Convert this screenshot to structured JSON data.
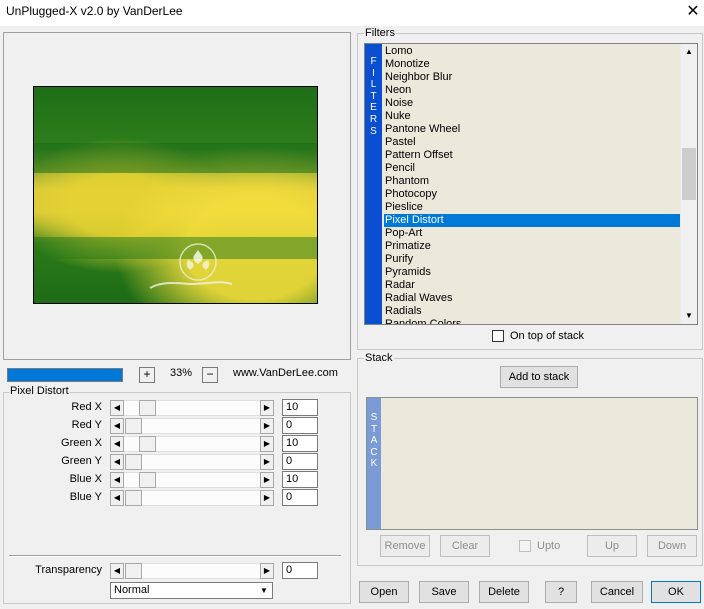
{
  "window": {
    "title": "UnPlugged-X v2.0 by VanDerLee",
    "close_glyph": "✕"
  },
  "zoom": {
    "plus": "+",
    "minus": "−",
    "value": "33%",
    "progress": 1.0
  },
  "website": "www.VanDerLee.com",
  "pixel_distort": {
    "label": "Pixel Distort",
    "params": [
      {
        "label": "Red X",
        "value": "10"
      },
      {
        "label": "Red Y",
        "value": "0"
      },
      {
        "label": "Green X",
        "value": "10"
      },
      {
        "label": "Green Y",
        "value": "0"
      },
      {
        "label": "Blue X",
        "value": "10"
      },
      {
        "label": "Blue Y",
        "value": "0"
      }
    ],
    "transparency": {
      "label": "Transparency",
      "value": "0"
    },
    "blend_mode": "Normal"
  },
  "filters": {
    "label": "Filters",
    "band_letters": [
      "F",
      "I",
      "L",
      "T",
      "E",
      "R",
      "S"
    ],
    "items": [
      "Lomo",
      "Monotize",
      "Neighbor Blur",
      "Neon",
      "Noise",
      "Nuke",
      "Pantone Wheel",
      "Pastel",
      "Pattern Offset",
      "Pencil",
      "Phantom",
      "Photocopy",
      "Pieslice",
      "Pixel Distort",
      "Pop-Art",
      "Primatize",
      "Purify",
      "Pyramids",
      "Radar",
      "Radial Waves",
      "Radials",
      "Random Colors"
    ],
    "selected": "Pixel Distort",
    "on_top_label": "On top of stack"
  },
  "stack": {
    "label": "Stack",
    "add_label": "Add to stack",
    "band_letters": [
      "S",
      "T",
      "A",
      "C",
      "K"
    ],
    "remove_label": "Remove",
    "clear_label": "Clear",
    "upto_label": "Upto",
    "up_label": "Up",
    "down_label": "Down"
  },
  "buttons": {
    "open": "Open",
    "save": "Save",
    "delete": "Delete",
    "help": "?",
    "cancel": "Cancel",
    "ok": "OK"
  },
  "colors": {
    "accent": "#0078d7",
    "filter_band": "#0a4fd1",
    "stack_band": "#7a9bd6",
    "list_bg": "#ebe8dc"
  }
}
